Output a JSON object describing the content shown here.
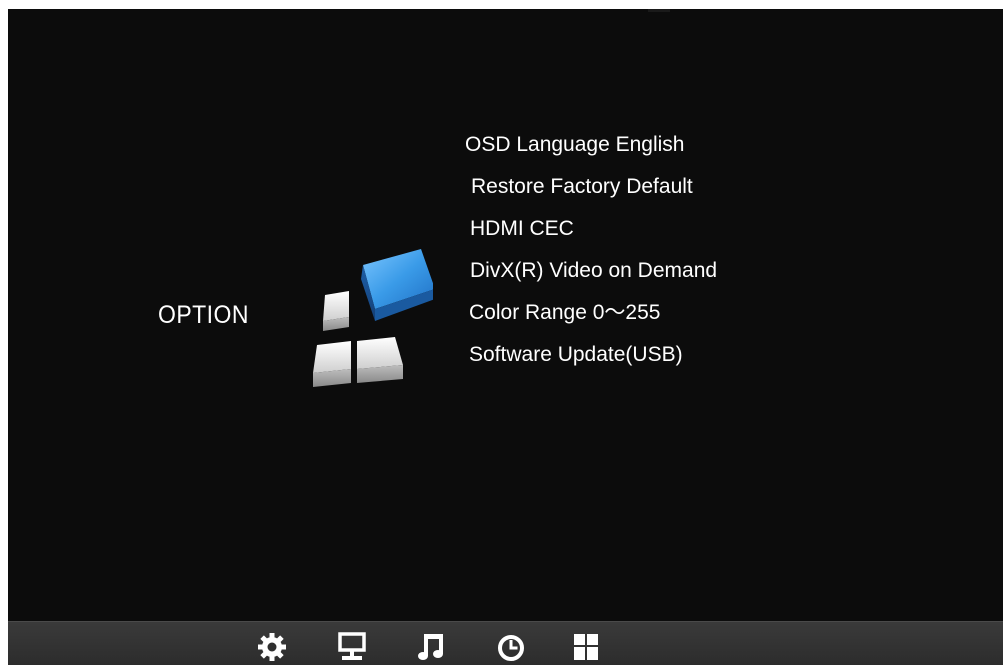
{
  "screen": {
    "title": "OPTION"
  },
  "menu": {
    "items": [
      {
        "label": "OSD Language English"
      },
      {
        "label": "Restore Factory Default"
      },
      {
        "label": "HDMI CEC"
      },
      {
        "label": "DivX(R) Video on Demand"
      },
      {
        "label": "Color Range 0～255"
      },
      {
        "label": "Software Update(USB)"
      }
    ]
  },
  "bottom_bar": {
    "icons": [
      "gear-icon",
      "monitor-icon",
      "music-note-icon",
      "clock-icon",
      "grid-icon"
    ]
  },
  "colors": {
    "background": "#0c0c0c",
    "text": "#ffffff",
    "accent_blue": "#3a9be8",
    "bar": "#333333"
  }
}
